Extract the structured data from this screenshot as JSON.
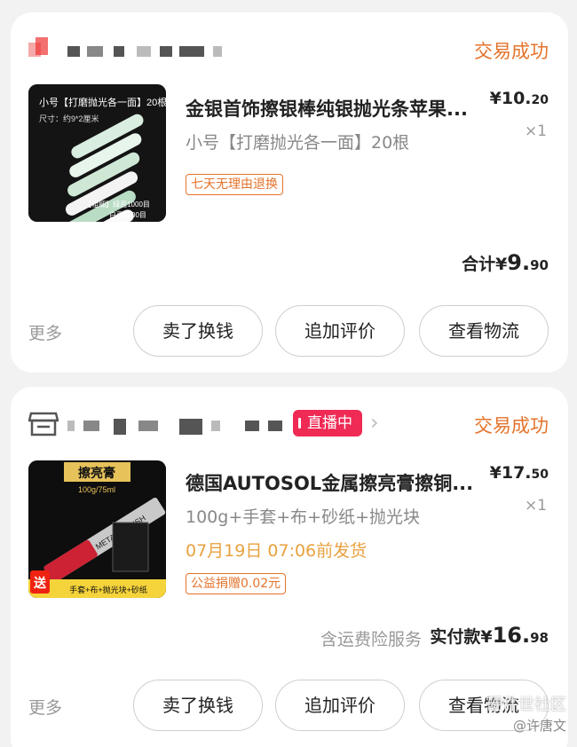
{
  "orders": [
    {
      "status": "交易成功",
      "product_title": "金银首饰擦银棒纯银抛光条苹果...",
      "spec": "小号【打磨抛光各一面】20根",
      "price_main": "¥10.",
      "price_decimal": "20",
      "qty": "×1",
      "tag": "七天无理由退换",
      "total_label": "合计¥",
      "total_main": "9.",
      "total_decimal": "90",
      "more": "更多",
      "buttons": [
        "卖了换钱",
        "追加评价",
        "查看物流"
      ],
      "thumb_text": {
        "header": "小号【打磨抛光各一面】20根",
        "size": "尺寸：约9*2厘米",
        "grit": "【粗细】绿面1000目",
        "grit2": "白面5000目"
      }
    },
    {
      "status": "交易成功",
      "live_badge": "直播中",
      "product_title": "德国AUTOSOL金属擦亮膏擦铜...",
      "spec": "100g+手套+布+砂纸+抛光块",
      "ship_time": "07月19日 07:06前发货",
      "price_main": "¥17.",
      "price_decimal": "50",
      "qty": "×1",
      "tag": "公益捐赠0.02元",
      "insurance": "含运费险服务",
      "total_label": "实付款¥",
      "total_main": "16.",
      "total_decimal": "98",
      "more": "更多",
      "buttons": [
        "卖了换钱",
        "追加评价",
        "查看物流"
      ],
      "thumb_text": {
        "header": "擦亮膏",
        "sub": "100g/75ml",
        "tube": "METAL POLISH",
        "gift": "送",
        "gift_line": "手套+布+抛光块+砂纸"
      }
    }
  ],
  "watermark": {
    "line1": "硬件世社区",
    "line2": "@许唐文"
  },
  "colors": {
    "accent": "#e4732b",
    "live": "#ef2a55",
    "ship": "#e8a13f"
  }
}
